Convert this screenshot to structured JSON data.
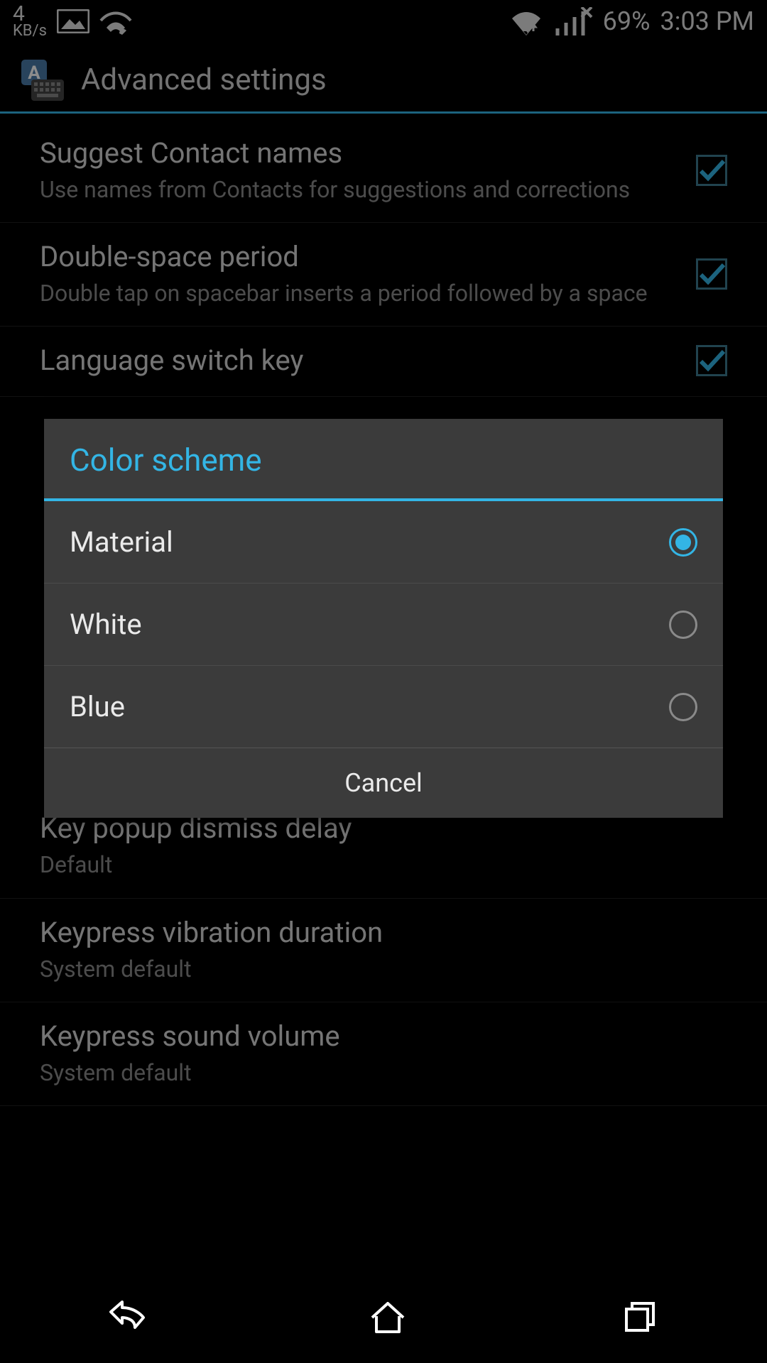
{
  "statusbar": {
    "speed_value": "4",
    "speed_unit": "KB/s",
    "battery": "69%",
    "time": "3:03 PM"
  },
  "actionbar": {
    "title": "Advanced settings"
  },
  "settings": {
    "suggest_contacts": {
      "title": "Suggest Contact names",
      "sub": "Use names from Contacts for suggestions and corrections"
    },
    "double_space": {
      "title": "Double-space period",
      "sub": "Double tap on spacebar inserts a period followed by a space"
    },
    "lang_switch": {
      "title": "Language switch key"
    },
    "key_popup_delay": {
      "title": "Key popup dismiss delay",
      "sub": "Default"
    },
    "vibration_duration": {
      "title": "Keypress vibration duration",
      "sub": "System default"
    },
    "sound_volume": {
      "title": "Keypress sound volume",
      "sub": "System default"
    }
  },
  "dialog": {
    "title": "Color scheme",
    "options": {
      "material": "Material",
      "white": "White",
      "blue": "Blue"
    },
    "selected": "material",
    "cancel": "Cancel"
  }
}
